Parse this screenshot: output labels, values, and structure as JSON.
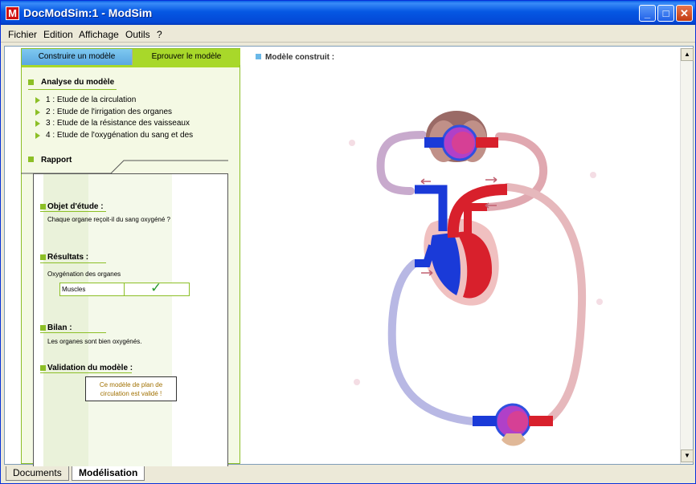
{
  "window": {
    "app_icon_letter": "M",
    "title": "DocModSim:1 - ModSim",
    "minimize_label": "_",
    "maximize_label": "□",
    "close_label": "✕"
  },
  "menubar": {
    "items": [
      "Fichier",
      "Edition",
      "Affichage",
      "Outils",
      "?"
    ]
  },
  "left_panel": {
    "tabs": [
      "Construire un modèle",
      "Eprouver le modèle"
    ],
    "active_tab": "Eprouver le modèle",
    "analysis": {
      "heading": "Analyse du modèle",
      "items": [
        "1 : Etude de la circulation",
        "2 : Etude de l'irrigation des organes",
        "3 : Etude de la résistance des vaisseaux",
        "4 : Etude de l'oxygénation du sang et des"
      ]
    },
    "report": {
      "heading": "Rapport",
      "objet_label": "Objet d'étude :",
      "objet_text": "Chaque organe reçoit-il du sang oxygéné ?",
      "results_label": "Résultats :",
      "results_text": "Oxygénation des organes",
      "results_row_label": "Muscles",
      "results_row_value": "✓",
      "bilan_label": "Bilan :",
      "bilan_text": "Les organes sont bien oxygénés.",
      "validation_label": "Validation du modèle :",
      "validation_text": "Ce modèle de plan de circulation est validé !"
    }
  },
  "diagram": {
    "title": "Modèle construit :"
  },
  "scrollbar": {
    "up": "▲",
    "down": "▼"
  },
  "bottom_tabs": {
    "items": [
      "Documents",
      "Modélisation"
    ],
    "active": "Modélisation"
  },
  "colors": {
    "accent_green": "#8cbf26",
    "oxygenated": "#d8202c",
    "deoxygenated": "#1a3ad8",
    "titlebar": "#0557e3"
  }
}
